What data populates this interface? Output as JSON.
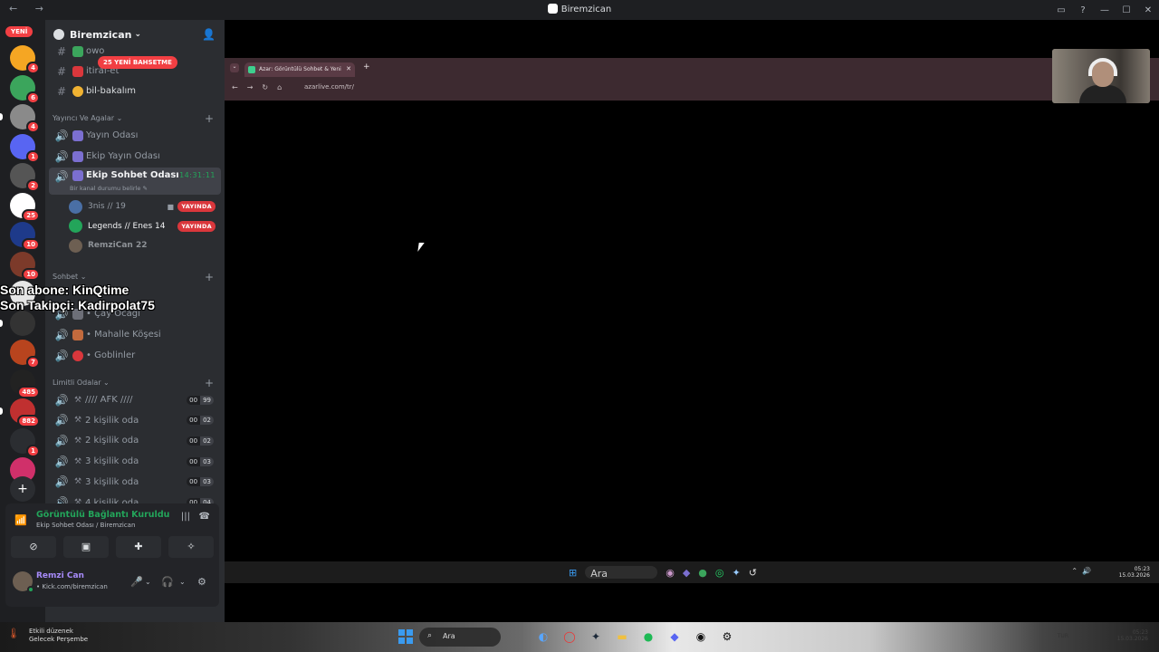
{
  "window": {
    "title": "Biremzican",
    "nav_arrows": "← →",
    "controls": [
      "▭",
      "?",
      "—",
      "☐",
      "✕"
    ]
  },
  "guilds": {
    "new_badge": "YENİ",
    "items": [
      {
        "color": "#f5a623",
        "badge": "4"
      },
      {
        "color": "#3ba55c",
        "badge": "6"
      },
      {
        "color": "#8a8a8a",
        "badge": "4"
      },
      {
        "color": "#5865f2",
        "badge": "1"
      },
      {
        "color": "#555555",
        "badge": "2"
      },
      {
        "color": "#ffffff",
        "badge": "25"
      },
      {
        "color": "#1e3a8a",
        "badge": "10"
      },
      {
        "color": "#7c3a2a",
        "badge": "10"
      },
      {
        "color": "#e6e6e6",
        "badge": ""
      },
      {
        "color": "#333333",
        "badge": ""
      },
      {
        "color": "#b8441e",
        "badge": "7"
      },
      {
        "color": "#222222",
        "badge": "485"
      },
      {
        "color": "#c03030",
        "badge": "882"
      },
      {
        "color": "#2b2d31",
        "badge": "1"
      },
      {
        "color": "#d0306a",
        "badge": ""
      }
    ],
    "add_label": "+",
    "explore_label": "◎"
  },
  "server": {
    "name": "Biremzican",
    "mention_pill": "25 YENİ BAHSETME",
    "top_channels": [
      {
        "icon": "#",
        "name": "owo"
      },
      {
        "icon": "#",
        "name": "itiraf-et"
      },
      {
        "icon": "#",
        "name": "bil-bakalım"
      }
    ],
    "categories": [
      {
        "name": "Yayıncı Ve Agalar ⌄"
      },
      {
        "name": "Sohbet ⌄"
      },
      {
        "name": "Limitli Odalar ⌄"
      }
    ],
    "stream_channels": [
      {
        "name": "Yayın Odası"
      },
      {
        "name": "Ekip Yayın Odası"
      }
    ],
    "active_channel": {
      "name": "Ekip Sohbet Odası",
      "timer": "14:31:11",
      "status": "Bir kanal durumu belirle ✎"
    },
    "voice_users": [
      {
        "name": "3nis // 19",
        "live": "YAYINDA",
        "color": "#4a6fa5"
      },
      {
        "name": "Legends // Enes 14",
        "live": "YAYINDA",
        "color": "#23a55a"
      },
      {
        "name": "RemziCan 22",
        "live": "",
        "color": "#6d5f52"
      }
    ],
    "sohbet_channels": [
      {
        "name": "• Çay Ocağı"
      },
      {
        "name": "• Mahalle Köşesi"
      },
      {
        "name": "• Goblinler"
      }
    ],
    "limited_channels": [
      {
        "name": "//// AFK ////",
        "now": "00",
        "max": "99"
      },
      {
        "name": "2 kişilik oda",
        "now": "00",
        "max": "02"
      },
      {
        "name": "2 kişilik oda",
        "now": "00",
        "max": "02"
      },
      {
        "name": "3 kişilik oda",
        "now": "00",
        "max": "03"
      },
      {
        "name": "3 kişilik oda",
        "now": "00",
        "max": "03"
      },
      {
        "name": "4 kişilik oda",
        "now": "00",
        "max": "04"
      }
    ]
  },
  "overlay": {
    "line1": "Son abone: KinQtime",
    "line2": "Son Takipçi: Kadirpolat75"
  },
  "voice": {
    "title": "Görüntülü Bağlantı Kuruldu",
    "subtitle": "Ekip Sohbet Odası / Biremzican"
  },
  "user": {
    "name": "Remzi Can",
    "status": "• Kick.com/biremzican"
  },
  "browser": {
    "tab_title": "Azar: Görüntülü Sohbet & Yeni",
    "url": "azarlive.com/tr/"
  },
  "inner_taskbar": {
    "search": "Ara",
    "time": "05:23",
    "date": "15.03.2026"
  },
  "taskbar": {
    "weather_title": "Etkili düzenek",
    "weather_sub": "Gelecek Perşembe",
    "search": "Ara",
    "lang": "TUR",
    "time": "05:23",
    "date": "15.03.2026"
  }
}
